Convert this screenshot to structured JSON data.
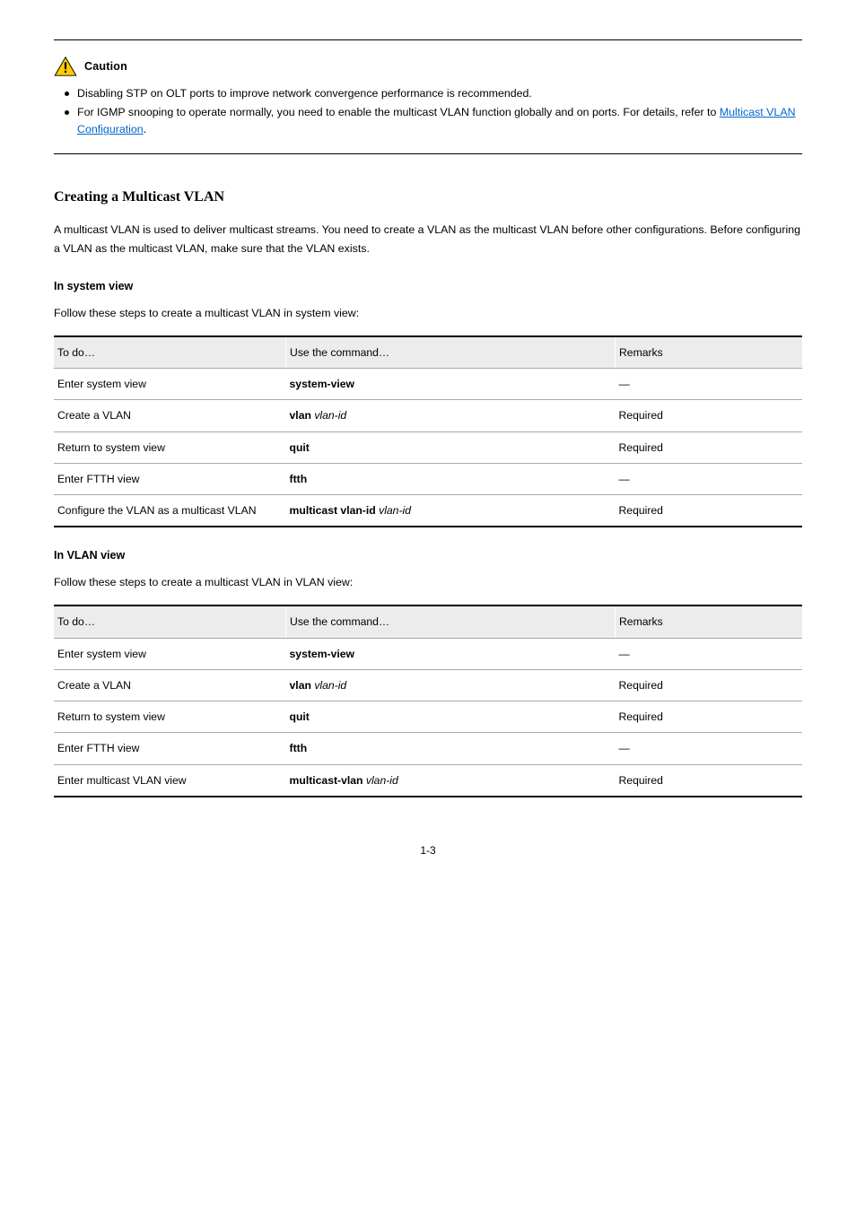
{
  "callout": {
    "label": "Caution",
    "bullets": [
      "Disabling STP on OLT ports to improve network convergence performance is recommended.",
      {
        "pre": "For IGMP snooping to operate normally, you need to enable the multicast VLAN function globally and on ports. For details, refer to ",
        "link": "Multicast VLAN Configuration",
        "post": "."
      }
    ]
  },
  "section1": {
    "title": "Creating a Multicast VLAN",
    "body": "A multicast VLAN is used to deliver multicast streams. You need to create a VLAN as the multicast VLAN before other configurations. Before configuring a VLAN as the multicast VLAN, make sure that the VLAN exists.",
    "view_label": "Follow these steps to create a multicast VLAN in system view:"
  },
  "table1": {
    "caption": "In system view",
    "headers": [
      "To do…",
      "Use the command…",
      "Remarks"
    ],
    "rows": [
      {
        "todo": "Enter system view",
        "cmd_b": "system-view",
        "cmd_i": "",
        "remarks": "—"
      },
      {
        "todo": "Create a VLAN",
        "cmd_b": "vlan ",
        "cmd_i": "vlan-id",
        "remarks": "Required"
      },
      {
        "todo": "Return to system view",
        "cmd_b": "quit",
        "cmd_i": "",
        "remarks": "Required"
      },
      {
        "todo": "Enter FTTH view",
        "cmd_b": "ftth",
        "cmd_i": "",
        "remarks": "—"
      },
      {
        "todo": "Configure the VLAN as a multicast VLAN",
        "cmd_b": "multicast vlan-id ",
        "cmd_i": "vlan-id",
        "remarks": "Required"
      }
    ]
  },
  "table2": {
    "caption": "In VLAN view",
    "view_label": "Follow these steps to create a multicast VLAN in VLAN view:",
    "headers": [
      "To do…",
      "Use the command…",
      "Remarks"
    ],
    "rows": [
      {
        "todo": "Enter system view",
        "cmd_b": "system-view",
        "cmd_i": "",
        "remarks": "—",
        "showdash": true
      },
      {
        "todo": "Create a VLAN",
        "cmd_b": "vlan ",
        "cmd_i": "vlan-id",
        "remarks": "Required"
      },
      {
        "todo": "Return to system view",
        "cmd_b": "quit",
        "cmd_i": "",
        "remarks": "Required"
      },
      {
        "todo": "Enter FTTH view",
        "cmd_b": "ftth",
        "cmd_i": "",
        "remarks": "—",
        "showdash": true
      },
      {
        "todo": "Enter multicast VLAN view",
        "cmd_b": "multicast-vlan ",
        "cmd_i": "vlan-id",
        "remarks": "Required"
      }
    ]
  },
  "page_number": "1-3"
}
